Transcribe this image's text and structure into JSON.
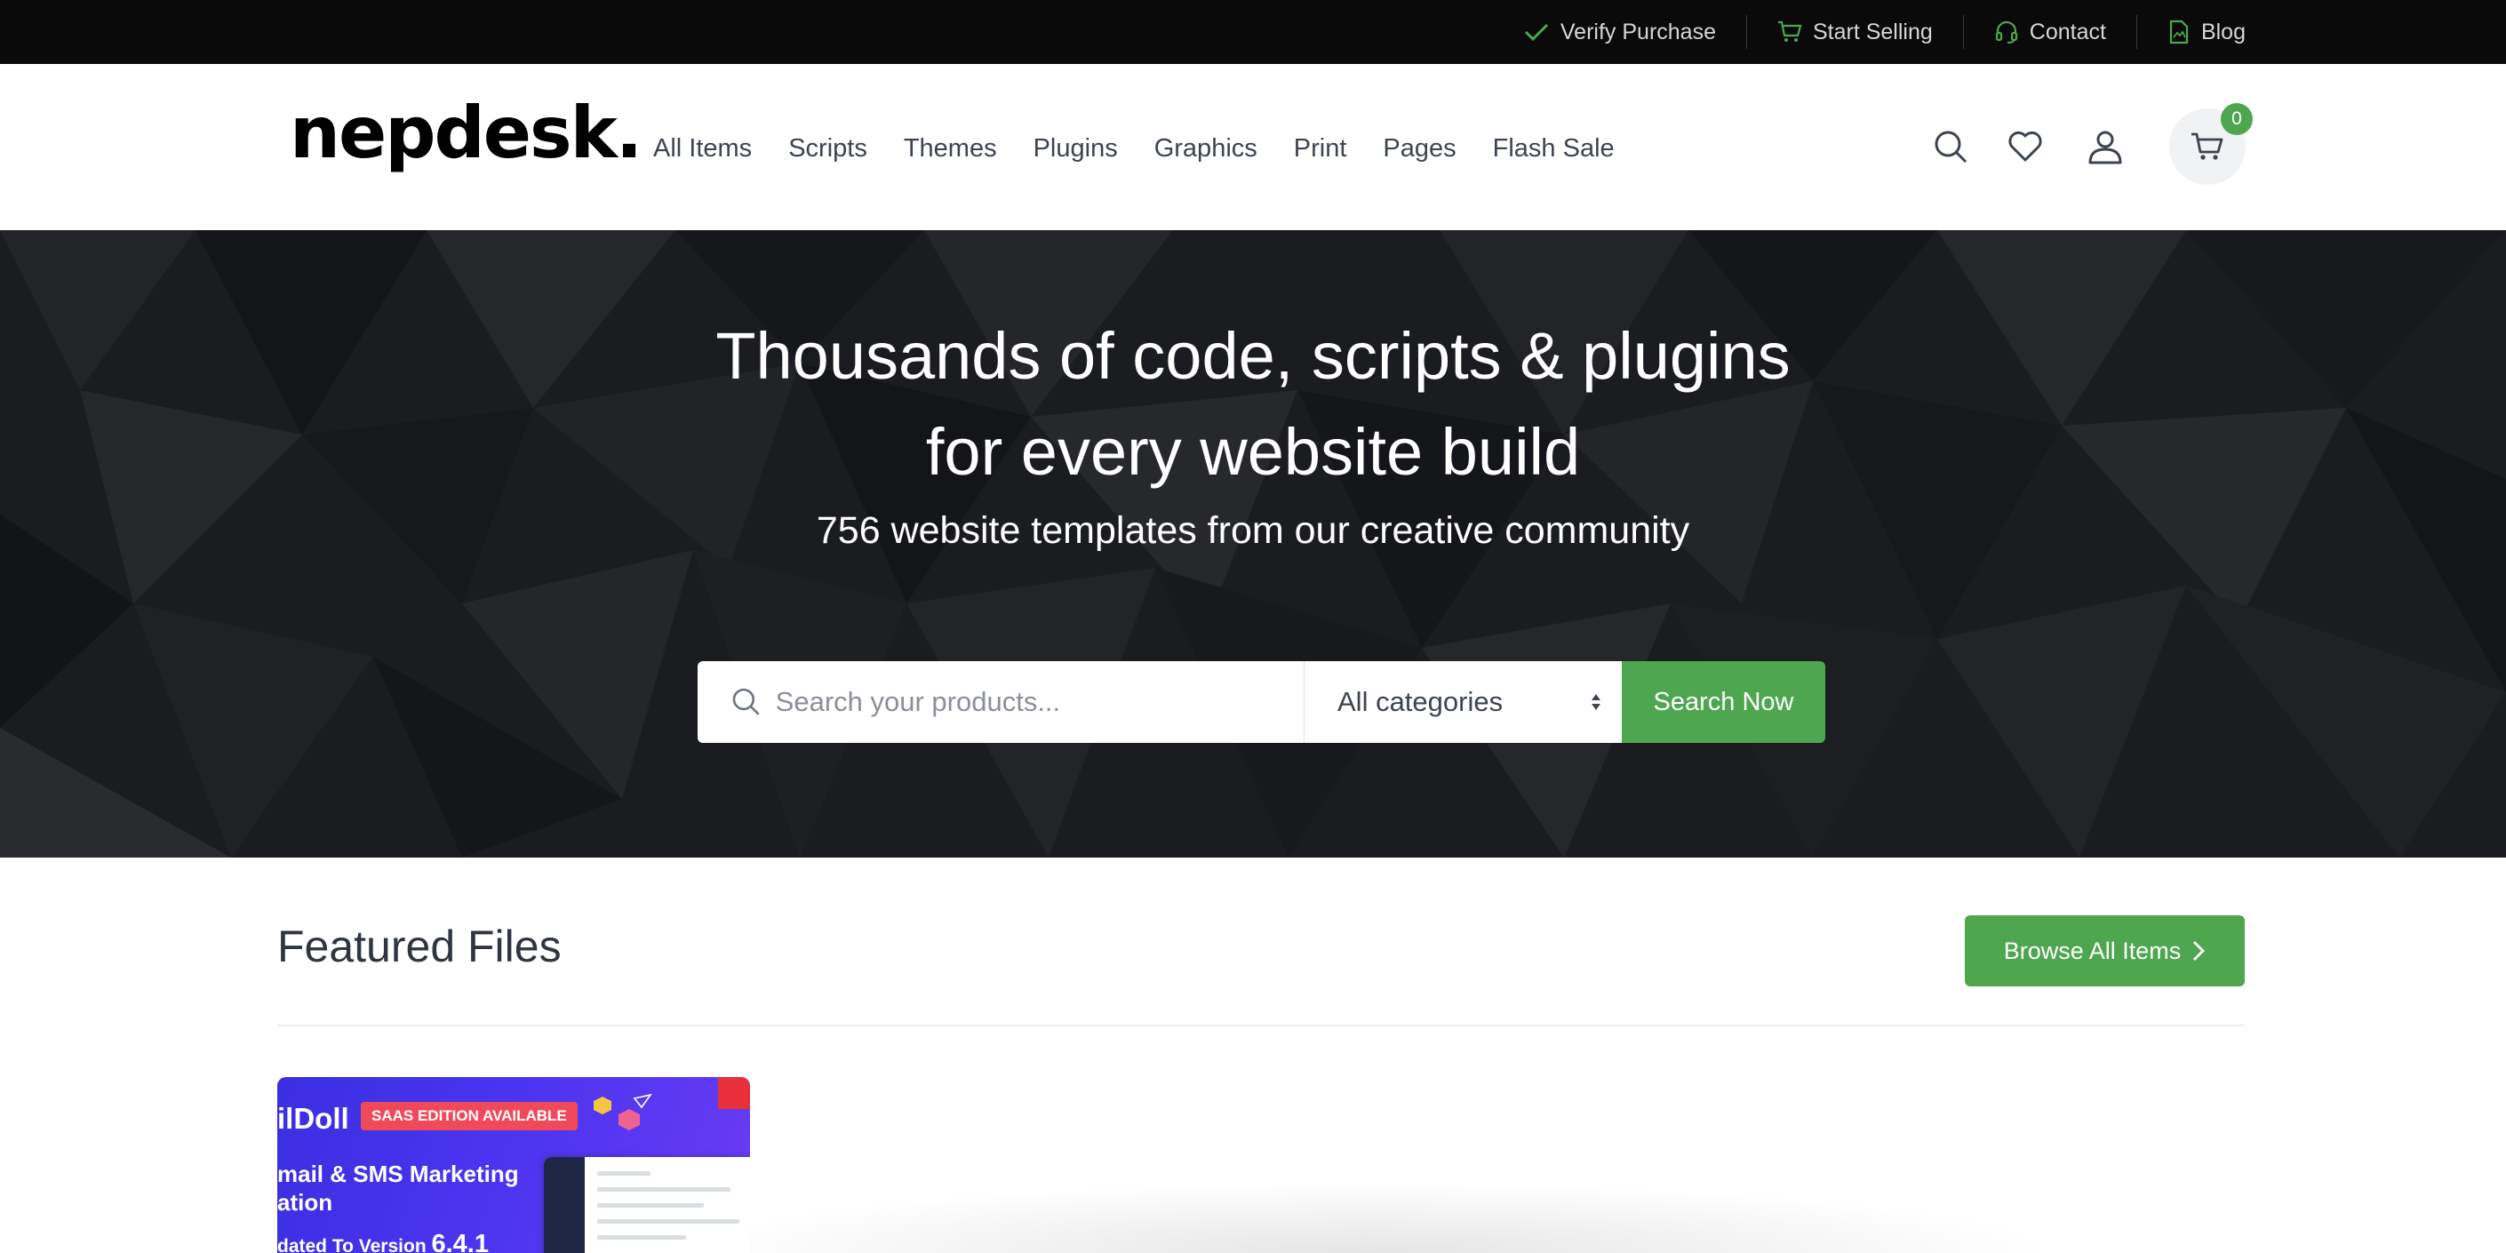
{
  "topbar": {
    "links": [
      {
        "label": "Verify Purchase",
        "icon": "check-icon"
      },
      {
        "label": "Start Selling",
        "icon": "cart-icon"
      },
      {
        "label": "Contact",
        "icon": "headset-icon"
      },
      {
        "label": "Blog",
        "icon": "document-icon"
      }
    ]
  },
  "header": {
    "logo": "nepdesk.",
    "menu": [
      "All Items",
      "Scripts",
      "Themes",
      "Plugins",
      "Graphics",
      "Print",
      "Pages",
      "Flash Sale"
    ],
    "cart_count": "0"
  },
  "hero": {
    "title_line1": "Thousands of code, scripts & plugins",
    "title_line2": "for every website build",
    "subtitle": "756 website templates from our creative community",
    "search_placeholder": "Search your products...",
    "category_selected": "All categories",
    "search_button": "Search Now"
  },
  "featured": {
    "title": "Featured Files",
    "browse_button": "Browse All Items",
    "card": {
      "brand": "ilDoll",
      "badge": "SAAS EDITION AVAILABLE",
      "line1": "mail & SMS Marketing",
      "line2": "ation",
      "line3_prefix": "dated To Version ",
      "line3_version": "6.4.1"
    }
  },
  "colors": {
    "accent": "#4ea64f",
    "topbar_bg": "#0a0a0a",
    "hero_bg": "#18191c"
  }
}
